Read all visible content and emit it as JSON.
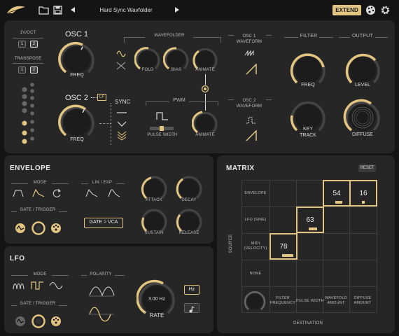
{
  "topbar": {
    "preset_name": "Hard Sync Wavfolder",
    "extend_label": "EXTEND"
  },
  "osc_panel": {
    "oct_label": "1V/OCT",
    "oct_buttons": [
      "1",
      "2"
    ],
    "transpose_label": "TRANSPOSE",
    "transpose_buttons": [
      "1",
      "2"
    ],
    "osc1_title": "OSC 1",
    "osc1_freq": "FREQ",
    "osc2_title": "OSC 2",
    "lf_label": "LF",
    "osc2_freq": "FREQ",
    "sync_label": "SYNC",
    "wavefolder_label": "WAVEFOLDER",
    "fold_label": "FOLD",
    "bias_label": "BIAS",
    "animate_label": "ANIMATE",
    "osc1_waveform": "OSC 1\nWAVEFORM",
    "osc2_waveform": "OSC 2\nWAVEFORM",
    "pwm_label": "PWM",
    "pulse_width_label": "PULSE WIDTH",
    "pwm_animate_label": "ANIMATE",
    "filter_label": "FILTER",
    "filter_freq": "FREQ",
    "key_track": "KEY\nTRACK",
    "output_label": "OUTPUT",
    "level_label": "LEVEL",
    "diffuse_label": "DIFFUSE"
  },
  "envelope": {
    "title": "ENVELOPE",
    "mode_label": "MODE",
    "lin_exp_label": "LIN / EXP",
    "gate_trigger_label": "GATE / TRIGGER",
    "gate_vca_label": "GATE > VCA",
    "attack": "ATTACK",
    "decay": "DECAY",
    "sustain": "SUSTAIN",
    "release": "RELEASE"
  },
  "lfo": {
    "title": "LFO",
    "mode_label": "MODE",
    "polarity_label": "POLARITY",
    "gate_trigger_label": "GATE / TRIGGER",
    "rate_value": "3.00 Hz",
    "rate_label": "RATE",
    "hz_label": "Hz"
  },
  "matrix": {
    "title": "MATRIX",
    "reset_label": "RESET",
    "source_label": "SOURCE",
    "destination_label": "DESTINATION",
    "sources": [
      "ENVELOPE",
      "LFO (SINE)",
      "MIDI\n(VELOCITY)",
      "NONE"
    ],
    "destinations": [
      "FILTER\nFREQUENCY",
      "PULSE WIDTH",
      "WAVEFOLD\nAMOUNT",
      "DIFFUSE\nAMOUNT"
    ],
    "cells": [
      {
        "row": 0,
        "col": 2,
        "value": "54"
      },
      {
        "row": 0,
        "col": 3,
        "value": "16"
      },
      {
        "row": 1,
        "col": 1,
        "value": "63"
      },
      {
        "row": 2,
        "col": 0,
        "value": "78"
      }
    ]
  },
  "colors": {
    "accent": "#e1c580",
    "panel": "#262626",
    "background": "#141414"
  }
}
